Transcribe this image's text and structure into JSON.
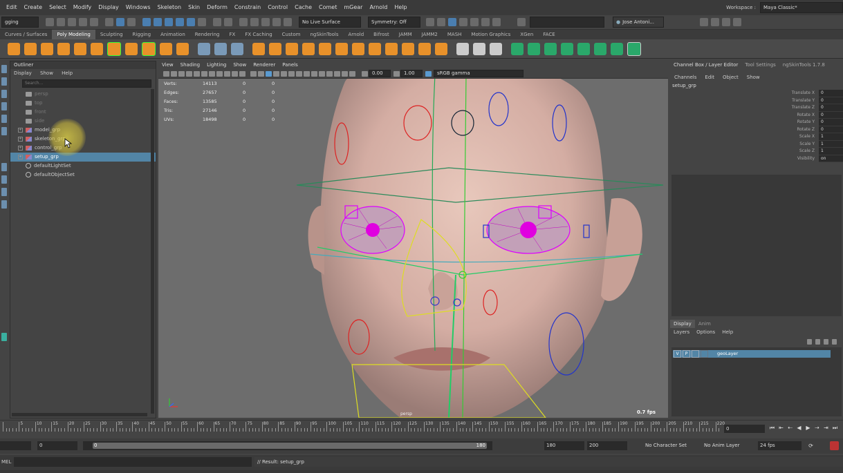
{
  "menubar": {
    "items": [
      "Edit",
      "Create",
      "Select",
      "Modify",
      "Display",
      "Windows",
      "Skeleton",
      "Skin",
      "Deform",
      "Constrain",
      "Control",
      "Cache",
      "Comet",
      "mGear",
      "Arnold",
      "Help"
    ],
    "workspace_label": "Workspace :",
    "workspace_value": "Maya Classic*"
  },
  "statusline": {
    "mode": "gging",
    "live_surface": "No Live Surface",
    "symmetry": "Symmetry: Off",
    "user": "Jose Antoni..."
  },
  "shelf": {
    "tabs": [
      "Curves / Surfaces",
      "Poly Modeling",
      "Sculpting",
      "Rigging",
      "Animation",
      "Rendering",
      "FX",
      "FX Caching",
      "Custom",
      "ngSkinTools",
      "Arnold",
      "Bifrost",
      "JAMM",
      "JAMM2",
      "MASH",
      "Motion Graphics",
      "XGen",
      "FACE"
    ],
    "active_tab": "Poly Modeling"
  },
  "outliner": {
    "title": "Outliner",
    "menu": [
      "Display",
      "Show",
      "Help"
    ],
    "search_placeholder": "Search...",
    "items": [
      {
        "label": "persp",
        "kind": "camera",
        "dim": true
      },
      {
        "label": "top",
        "kind": "camera",
        "dim": true
      },
      {
        "label": "front",
        "kind": "camera",
        "dim": true
      },
      {
        "label": "side",
        "kind": "camera",
        "dim": true
      },
      {
        "label": "model_grp",
        "kind": "group",
        "dim": false
      },
      {
        "label": "skeleton_grp",
        "kind": "group",
        "dim": false
      },
      {
        "label": "control_grp",
        "kind": "group",
        "dim": false
      },
      {
        "label": "setup_grp",
        "kind": "group",
        "dim": false,
        "selected": true
      },
      {
        "label": "defaultLightSet",
        "kind": "set",
        "dim": false
      },
      {
        "label": "defaultObjectSet",
        "kind": "set",
        "dim": false
      }
    ]
  },
  "viewport": {
    "menu": [
      "View",
      "Shading",
      "Lighting",
      "Show",
      "Renderer",
      "Panels"
    ],
    "exposure": "0.00",
    "gamma": "1.00",
    "color_space": "sRGB gamma",
    "hud": [
      {
        "label": "Verts:",
        "v1": "14113",
        "v2": "0",
        "v3": "0"
      },
      {
        "label": "Edges:",
        "v1": "27657",
        "v2": "0",
        "v3": "0"
      },
      {
        "label": "Faces:",
        "v1": "13585",
        "v2": "0",
        "v3": "0"
      },
      {
        "label": "Tris:",
        "v1": "27146",
        "v2": "0",
        "v3": "0"
      },
      {
        "label": "UVs:",
        "v1": "18498",
        "v2": "0",
        "v3": "0"
      }
    ],
    "camera": "persp",
    "fps": "0.7 fps"
  },
  "channelbox": {
    "tabs": [
      "Channel Box / Layer Editor",
      "Tool Settings",
      "ngSkinTools 1.7.8"
    ],
    "menu": [
      "Channels",
      "Edit",
      "Object",
      "Show"
    ],
    "object": "setup_grp",
    "channels": [
      {
        "name": "Translate X",
        "value": "0"
      },
      {
        "name": "Translate Y",
        "value": "0"
      },
      {
        "name": "Translate Z",
        "value": "0"
      },
      {
        "name": "Rotate X",
        "value": "0"
      },
      {
        "name": "Rotate Y",
        "value": "0"
      },
      {
        "name": "Rotate Z",
        "value": "0"
      },
      {
        "name": "Scale X",
        "value": "1"
      },
      {
        "name": "Scale Y",
        "value": "1"
      },
      {
        "name": "Scale Z",
        "value": "1"
      },
      {
        "name": "Visibility",
        "value": "on"
      }
    ]
  },
  "layer_editor": {
    "tabs": [
      "Display",
      "Anim"
    ],
    "menu": [
      "Layers",
      "Options",
      "Help"
    ],
    "layers": [
      {
        "v": "V",
        "p": "P",
        "name": "geoLayer"
      }
    ]
  },
  "timeline": {
    "ticks": [
      "5",
      "10",
      "15",
      "20",
      "25",
      "30",
      "35",
      "40",
      "45",
      "50",
      "55",
      "60",
      "65",
      "70",
      "75",
      "80",
      "85",
      "90",
      "95",
      "100",
      "105",
      "110",
      "115",
      "120",
      "125",
      "130",
      "135",
      "140",
      "145",
      "150",
      "155",
      "160",
      "165",
      "170",
      "175",
      "180",
      "185",
      "190",
      "195",
      "200",
      "205",
      "210",
      "215",
      "220"
    ],
    "current_frame": "0"
  },
  "range": {
    "start": "0",
    "inner_start": "0",
    "inner_end": "180",
    "end": "180",
    "max": "200",
    "character_set": "No Character Set",
    "anim_layer": "No Anim Layer",
    "fps": "24 fps"
  },
  "cmdline": {
    "label": "MEL",
    "result": "// Result: setup_grp"
  }
}
